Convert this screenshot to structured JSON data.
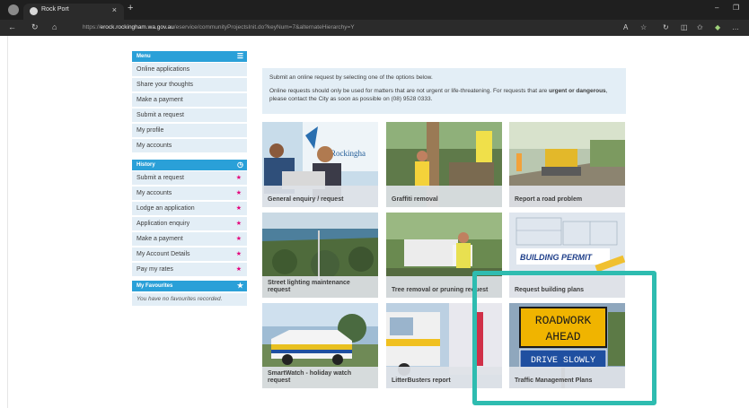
{
  "browser": {
    "tab_title": "Rock Port",
    "tab_close": "×",
    "new_tab": "+",
    "url_prefix": "https://",
    "url_host": "erock.rockingham.wa.gov.au",
    "url_path": "/eservice/communityProjectsInit.do?keyNum=7&alternateHierarchy=Y"
  },
  "sidebar": {
    "menu": {
      "title": "Menu",
      "items": [
        "Online applications",
        "Share your thoughts",
        "Make a payment",
        "Submit a request",
        "My profile",
        "My accounts"
      ]
    },
    "history": {
      "title": "History",
      "items": [
        "Submit a request",
        "My accounts",
        "Lodge an application",
        "Application enquiry",
        "Make a payment",
        "My Account Details",
        "Pay my rates"
      ]
    },
    "favourites": {
      "title": "My Favourites",
      "empty_text": "You have no favourites recorded."
    }
  },
  "intro": {
    "line1": "Submit an online request by selecting one of the options below.",
    "line2_start": "Online requests should only be used for matters that are not urgent or life-threatening. For requests that are ",
    "line2_bold": "urgent or dangerous",
    "line2_end": ", please contact the City as soon as possible on (08) 9528 0333."
  },
  "tiles": [
    {
      "label": "General enquiry / request"
    },
    {
      "label": "Graffiti removal"
    },
    {
      "label": "Report a road problem"
    },
    {
      "label": "Street lighting maintenance request"
    },
    {
      "label": "Tree removal or pruning request"
    },
    {
      "label": "Request building plans"
    },
    {
      "label": "SmartWatch - holiday watch request"
    },
    {
      "label": "LitterBusters report"
    },
    {
      "label": "Traffic Management Plans"
    }
  ],
  "tile_texts": {
    "rockingham": "Rockingha",
    "building_permit": "BUILDING PERMIT",
    "roadwork1": "ROADWORK",
    "roadwork2": "AHEAD",
    "drive_slowly": "DRIVE SLOWLY"
  },
  "colors": {
    "accent": "#2aa0d8",
    "highlight": "#2ebcb0",
    "star": "#e4007c"
  }
}
